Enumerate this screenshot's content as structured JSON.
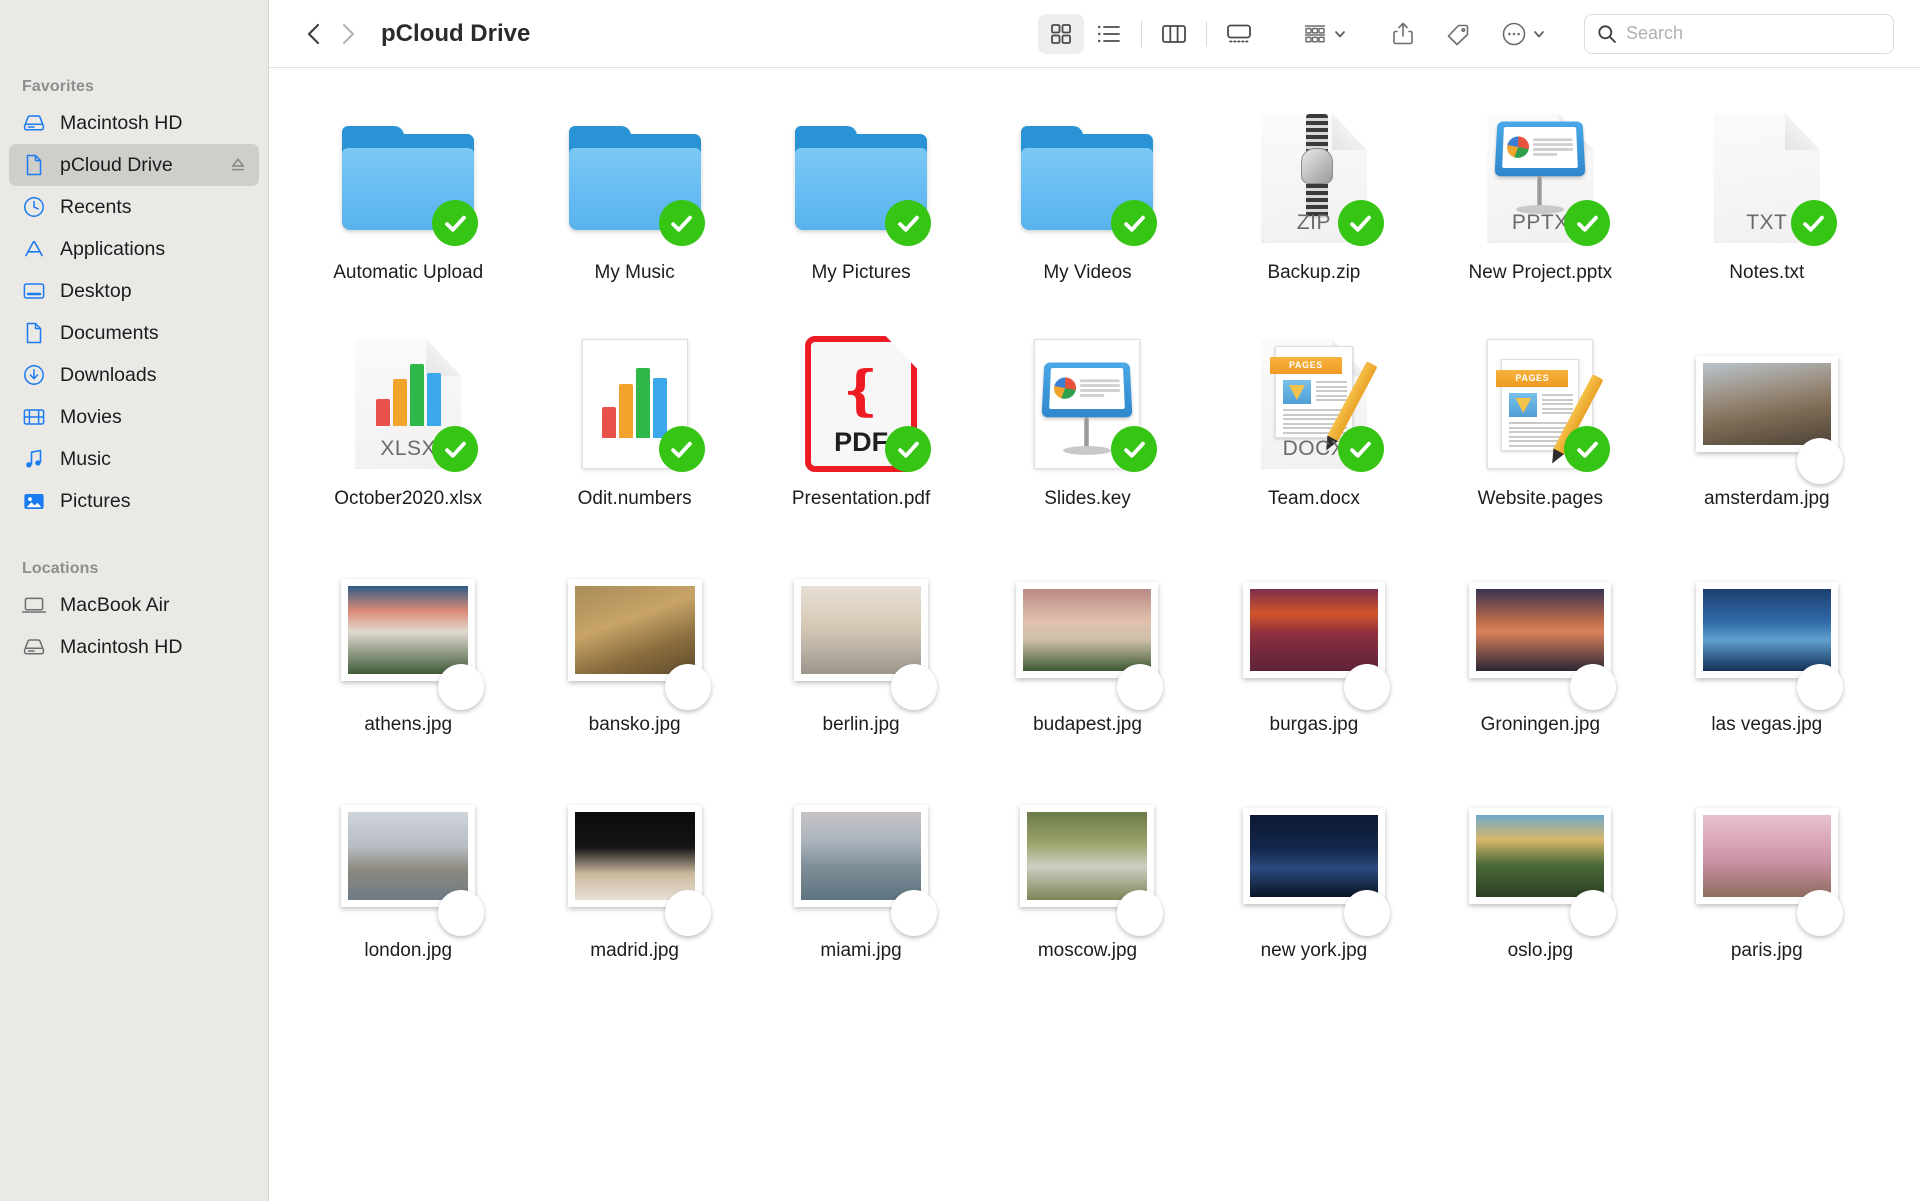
{
  "sidebar": {
    "sections": [
      {
        "title": "Favorites",
        "items": [
          {
            "label": "Macintosh HD",
            "icon": "hard-drive-icon",
            "active": false
          },
          {
            "label": "pCloud Drive",
            "icon": "document-icon",
            "active": true,
            "eject": true
          },
          {
            "label": "Recents",
            "icon": "clock-icon",
            "active": false
          },
          {
            "label": "Applications",
            "icon": "app-store-icon",
            "active": false
          },
          {
            "label": "Desktop",
            "icon": "desktop-icon",
            "active": false
          },
          {
            "label": "Documents",
            "icon": "document-icon",
            "active": false
          },
          {
            "label": "Downloads",
            "icon": "download-icon",
            "active": false
          },
          {
            "label": "Movies",
            "icon": "film-icon",
            "active": false
          },
          {
            "label": "Music",
            "icon": "music-note-icon",
            "active": false
          },
          {
            "label": "Pictures",
            "icon": "photo-icon",
            "active": false
          }
        ]
      },
      {
        "title": "Locations",
        "items": [
          {
            "label": "MacBook Air",
            "icon": "laptop-icon",
            "active": false
          },
          {
            "label": "Macintosh HD",
            "icon": "hard-drive-icon",
            "active": false
          }
        ]
      }
    ]
  },
  "toolbar": {
    "back_label": "Back",
    "forward_label": "Forward",
    "path_title": "pCloud Drive",
    "views": [
      {
        "name": "icon-view",
        "label": "Icon View",
        "active": true
      },
      {
        "name": "list-view",
        "label": "List View",
        "active": false
      },
      {
        "name": "column-view",
        "label": "Column View",
        "active": false
      },
      {
        "name": "gallery-view",
        "label": "Gallery View",
        "active": false
      }
    ],
    "group_label": "Group",
    "share_label": "Share",
    "tag_label": "Tags",
    "more_label": "More"
  },
  "search": {
    "placeholder": "Search",
    "value": ""
  },
  "colors": {
    "sync_badge": "#36c415",
    "folder_blue": "#66bcf2",
    "folder_tab": "#2a93d5",
    "pdf_red": "#ee1b24",
    "pages_orange": "#ef9a22",
    "sidebar_bg": "#ebe9e6",
    "selection": "#d0cecb",
    "accent_blue": "#0a7cff"
  },
  "files": [
    {
      "name": "Automatic Upload",
      "kind": "folder",
      "synced": true
    },
    {
      "name": "My Music",
      "kind": "folder",
      "synced": true
    },
    {
      "name": "My Pictures",
      "kind": "folder",
      "synced": true
    },
    {
      "name": "My Videos",
      "kind": "folder",
      "synced": true
    },
    {
      "name": "Backup.zip",
      "kind": "zip",
      "ext": "ZIP",
      "synced": true
    },
    {
      "name": "New Project.pptx",
      "kind": "keynote-doc",
      "ext": "PPTX",
      "synced": true
    },
    {
      "name": "Notes.txt",
      "kind": "text",
      "ext": "TXT",
      "synced": true
    },
    {
      "name": "October2020.xlsx",
      "kind": "chart-doc",
      "ext": "XLSX",
      "synced": true
    },
    {
      "name": "Odit.numbers",
      "kind": "numbers",
      "synced": true
    },
    {
      "name": "Presentation.pdf",
      "kind": "pdf",
      "ext": "PDF",
      "synced": true
    },
    {
      "name": "Slides.key",
      "kind": "keynote",
      "synced": true
    },
    {
      "name": "Team.docx",
      "kind": "pages-doc",
      "ext": "DOCX",
      "synced": true
    },
    {
      "name": "Website.pages",
      "kind": "pages",
      "synced": true
    },
    {
      "name": "amsterdam.jpg",
      "kind": "photo",
      "synced": true,
      "wide": true,
      "swatch": "linear-gradient(170deg,#b9c4cd 0%,#9a8d7e 38%,#7d6b55 62%,#4e4337 100%)"
    },
    {
      "name": "athens.jpg",
      "kind": "photo",
      "synced": true,
      "swatch": "linear-gradient(180deg,#2f5c86 0%,#d98a76 28%,#e0d9cf 52%,#3f5a39 100%)"
    },
    {
      "name": "bansko.jpg",
      "kind": "photo",
      "synced": true,
      "swatch": "linear-gradient(160deg,#a98c58 0%,#c8a468 40%,#8a6d3e 70%,#5e4a2b 100%)"
    },
    {
      "name": "berlin.jpg",
      "kind": "photo",
      "synced": true,
      "swatch": "linear-gradient(180deg,#e7dfd6 0%,#d6c9b6 45%,#bdb3a6 70%,#9c958c 100%)"
    },
    {
      "name": "budapest.jpg",
      "kind": "photo",
      "synced": true,
      "wide": true,
      "swatch": "linear-gradient(180deg,#b98a86 0%,#e2c2ae 40%,#cdbfa8 62%,#3f5a35 100%)"
    },
    {
      "name": "burgas.jpg",
      "kind": "photo",
      "synced": true,
      "wide": true,
      "swatch": "linear-gradient(180deg,#7a2f4c 0%,#d3542a 30%,#8c2f3e 55%,#5e2339 100%)"
    },
    {
      "name": "Groningen.jpg",
      "kind": "photo",
      "synced": true,
      "wide": true,
      "swatch": "linear-gradient(180deg,#3a3352 0%,#b9694a 38%,#d9815a 52%,#2d2536 100%)"
    },
    {
      "name": "las vegas.jpg",
      "kind": "photo",
      "synced": true,
      "wide": true,
      "swatch": "linear-gradient(180deg,#1d3f6e 0%,#2f6aa8 40%,#5fa0cf 62%,#123055 100%)"
    },
    {
      "name": "london.jpg",
      "kind": "photo",
      "synced": true,
      "swatch": "linear-gradient(180deg,#cfd4da 0%,#b7bcc2 40%,#8c8a80 65%,#6f7a85 100%)"
    },
    {
      "name": "madrid.jpg",
      "kind": "photo",
      "synced": true,
      "swatch": "linear-gradient(180deg,#0b0b0b 0%,#141414 40%,#c9b79c 70%,#e8e2d6 100%)"
    },
    {
      "name": "miami.jpg",
      "kind": "photo",
      "synced": true,
      "swatch": "linear-gradient(180deg,#c9c2c8 0%,#a9b2bb 35%,#7f8f99 62%,#5d737f 100%)"
    },
    {
      "name": "moscow.jpg",
      "kind": "photo",
      "synced": true,
      "swatch": "linear-gradient(180deg,#6b7a4a 0%,#9aa36a 35%,#cfcfc2 62%,#7d8458 100%)"
    },
    {
      "name": "new york.jpg",
      "kind": "photo",
      "synced": true,
      "wide": true,
      "swatch": "linear-gradient(180deg,#0d1a33 0%,#13264a 40%,#2b4a7e 65%,#0a1426 100%)"
    },
    {
      "name": "oslo.jpg",
      "kind": "photo",
      "synced": true,
      "wide": true,
      "swatch": "linear-gradient(180deg,#6fa8c9 0%,#d8b76a 30%,#4c6b3a 60%,#2c3f22 100%)"
    },
    {
      "name": "paris.jpg",
      "kind": "photo",
      "synced": true,
      "wide": true,
      "swatch": "linear-gradient(180deg,#e7c0cf 0%,#d8a4b8 35%,#c58f9e 60%,#8e6b5e 100%)"
    }
  ]
}
